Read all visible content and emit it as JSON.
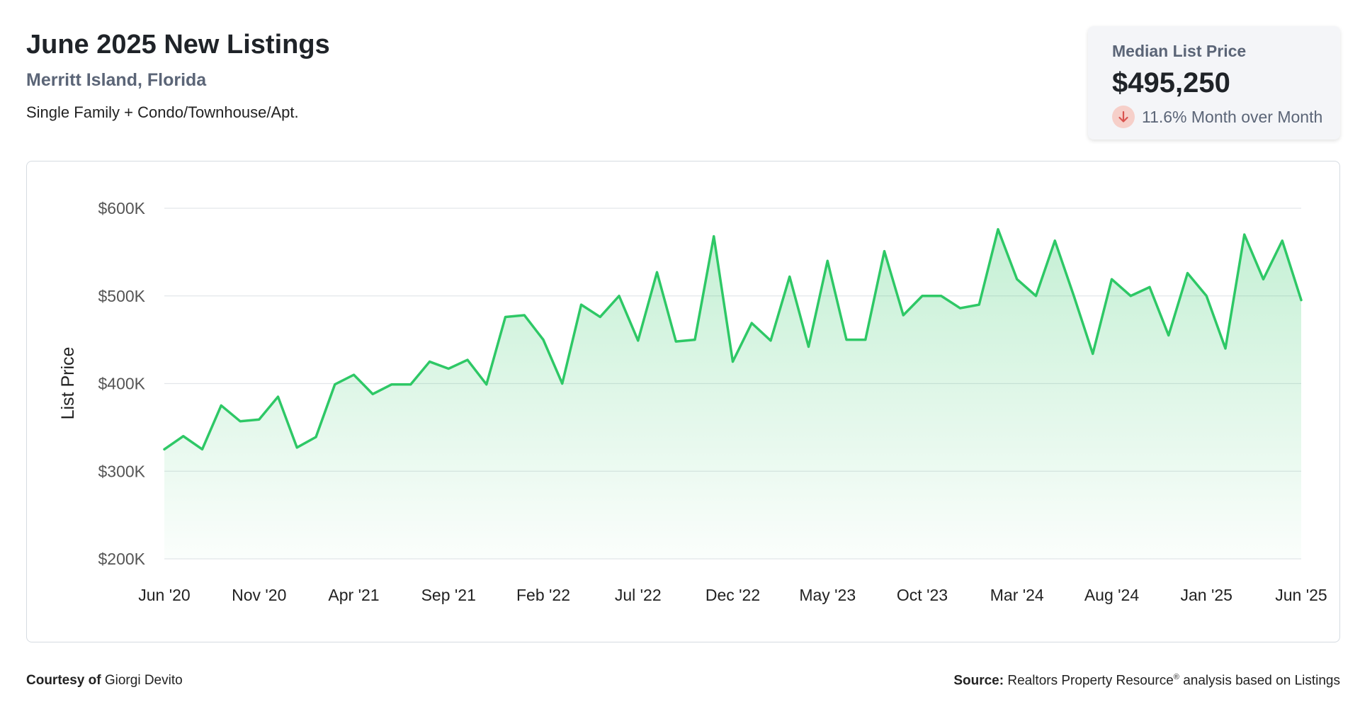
{
  "header": {
    "title": "June 2025 New Listings",
    "location": "Merritt Island, Florida",
    "property_types": "Single Family + Condo/Townhouse/Apt."
  },
  "kpi": {
    "label": "Median List Price",
    "value": "$495,250",
    "change_text": "11.6% Month over Month",
    "direction_icon": "arrow-down-icon",
    "icon_color": "#d9534f"
  },
  "footer": {
    "courtesy_label": "Courtesy of",
    "courtesy_name": "Giorgi Devito",
    "source_label": "Source:",
    "source_text": "Realtors Property Resource",
    "source_reg": "®",
    "source_suffix": "analysis based on Listings"
  },
  "chart_data": {
    "type": "area",
    "ylabel": "List Price",
    "ylim": [
      200000,
      600000
    ],
    "yticks": [
      200000,
      300000,
      400000,
      500000,
      600000
    ],
    "ytick_labels": [
      "$200K",
      "$300K",
      "$400K",
      "$500K",
      "$600K"
    ],
    "xtick_labels": [
      "Jun '20",
      "Nov '20",
      "Apr '21",
      "Sep '21",
      "Feb '22",
      "Jul '22",
      "Dec '22",
      "May '23",
      "Oct '23",
      "Mar '24",
      "Aug '24",
      "Jan '25",
      "Jun '25"
    ],
    "xtick_step": 5,
    "grid": true,
    "line_color": "#2ec866",
    "fill_color": "#2ec866",
    "values": [
      325000,
      340000,
      325000,
      375000,
      357000,
      359000,
      385000,
      327000,
      339000,
      399000,
      410000,
      388000,
      399000,
      399000,
      425000,
      417000,
      427000,
      399000,
      476000,
      478000,
      450000,
      400000,
      490000,
      476000,
      500000,
      449000,
      527000,
      448000,
      450000,
      568000,
      425000,
      469000,
      449000,
      522000,
      442000,
      540000,
      450000,
      450000,
      551000,
      478000,
      500000,
      500000,
      486000,
      490000,
      576000,
      519000,
      500000,
      563000,
      500000,
      434000,
      519000,
      500000,
      510000,
      455000,
      526000,
      500000,
      440000,
      570000,
      519000,
      563000,
      495250
    ]
  }
}
